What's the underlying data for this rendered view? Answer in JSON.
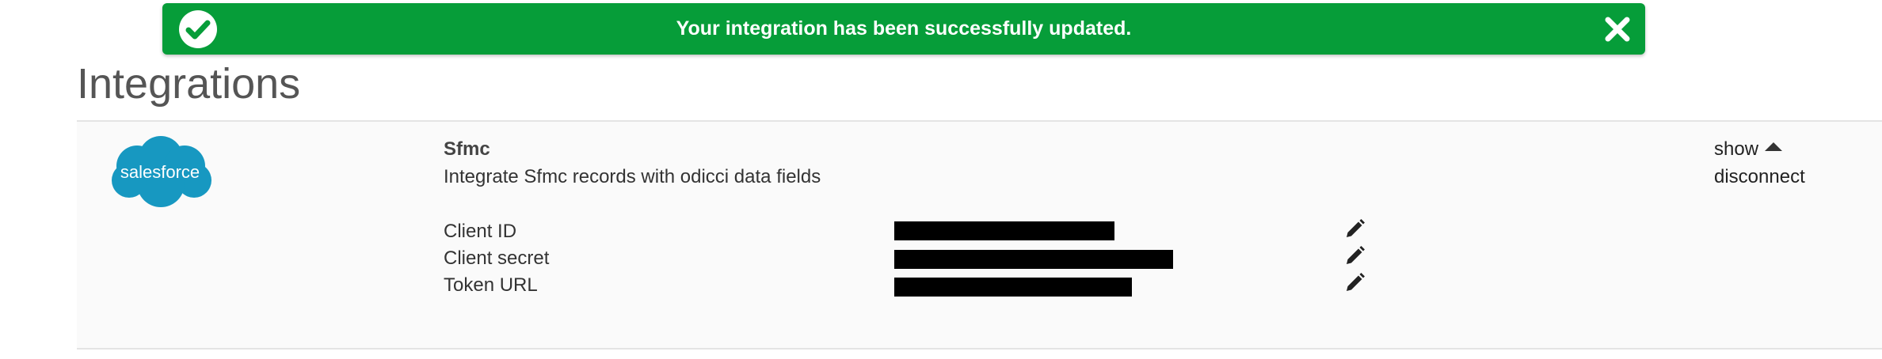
{
  "toast": {
    "message": "Your integration has been successfully updated.",
    "icon": "check-circle-icon",
    "close_icon": "close-icon",
    "color": "#069d39"
  },
  "page": {
    "title": "Integrations"
  },
  "integration": {
    "logo_text": "salesforce",
    "logo_color": "#1798c1",
    "name": "Sfmc",
    "description": "Integrate Sfmc records with odicci data fields",
    "toggle_label": "show",
    "toggle_icon": "caret-up-icon",
    "disconnect_label": "disconnect",
    "fields": [
      {
        "label": "Client ID",
        "value_state": "redacted",
        "edit_icon": "pencil-icon"
      },
      {
        "label": "Client secret",
        "value_state": "redacted",
        "edit_icon": "pencil-icon"
      },
      {
        "label": "Token URL",
        "value_state": "redacted",
        "edit_icon": "pencil-icon"
      }
    ]
  }
}
